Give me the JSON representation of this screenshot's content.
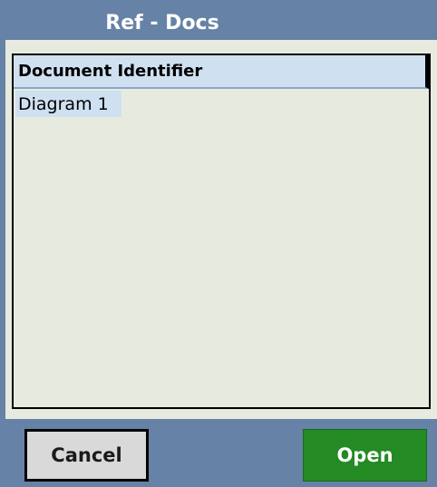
{
  "window": {
    "title": "Ref - Docs"
  },
  "list": {
    "column_header": "Document Identifier",
    "items": [
      {
        "label": "Diagram 1",
        "selected": true
      }
    ]
  },
  "buttons": {
    "cancel_label": "Cancel",
    "open_label": "Open"
  },
  "colors": {
    "frame": "#6682a6",
    "content_bg": "#e7ebdf",
    "selection": "#cfe0f1",
    "open_button": "#248a24",
    "cancel_button": "#d9d9d9"
  }
}
